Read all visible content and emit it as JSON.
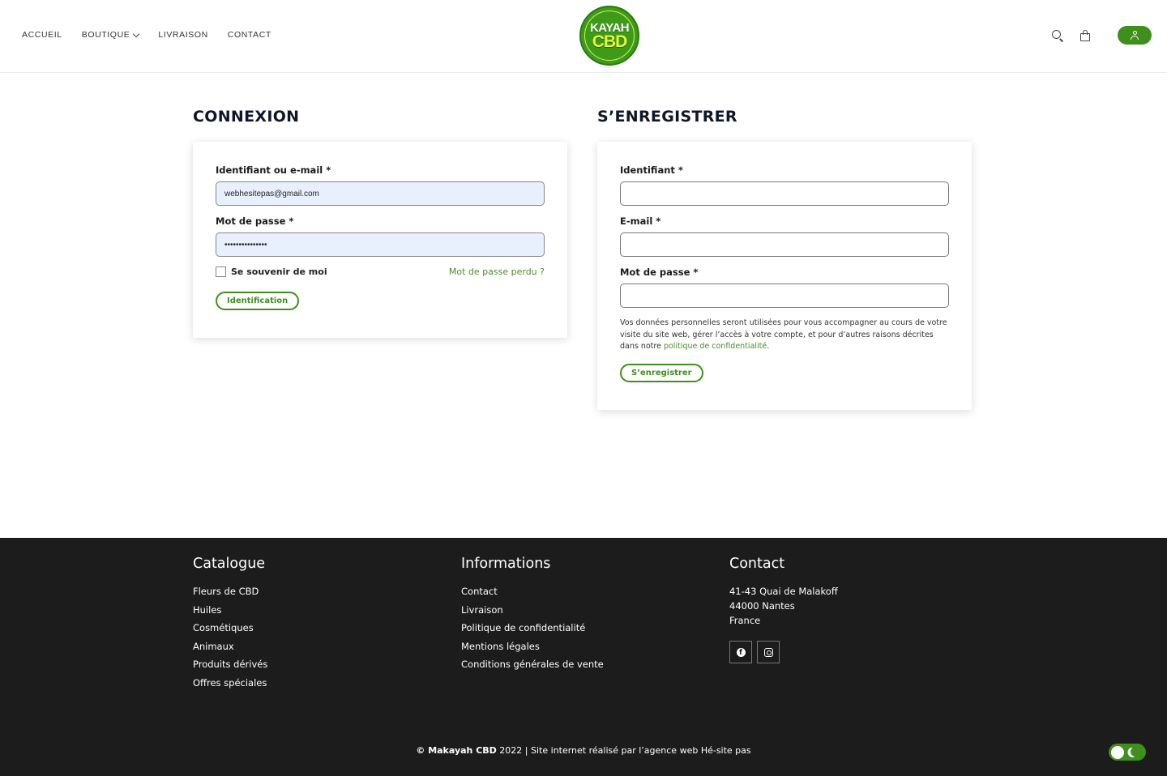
{
  "header": {
    "nav": [
      {
        "label": "ACCUEIL"
      },
      {
        "label": "BOUTIQUE",
        "has_dropdown": true
      },
      {
        "label": "LIVRAISON"
      },
      {
        "label": "CONTACT"
      }
    ],
    "logo": {
      "line1": "KAYAH",
      "line2": "CBD"
    },
    "icons": [
      "search-icon",
      "bag-icon",
      "user-icon"
    ]
  },
  "login": {
    "title": "CONNEXION",
    "username_label": "Identifiant ou e-mail *",
    "username_value": "webhesitepas@gmail.com",
    "password_label": "Mot de passe *",
    "password_value": "•••••••••••••••",
    "remember_label": "Se souvenir de moi",
    "lost_password": "Mot de passe perdu ?",
    "submit": "Identification"
  },
  "register": {
    "title": "S’ENREGISTRER",
    "username_label": "Identifiant *",
    "email_label": "E-mail *",
    "password_label": "Mot de passe *",
    "privacy_text": "Vos données personnelles seront utilisées pour vous accompagner au cours de votre visite du site web, gérer l’accès à votre compte, et pour d’autres raisons décrites dans notre ",
    "privacy_link": "politique de confidentialité",
    "privacy_end": ".",
    "submit": "S’enregistrer"
  },
  "footer": {
    "catalogue": {
      "title": "Catalogue",
      "items": [
        "Fleurs de CBD",
        "Huiles",
        "Cosmétiques",
        "Animaux",
        "Produits dérivés",
        "Offres spéciales"
      ]
    },
    "informations": {
      "title": "Informations",
      "items": [
        "Contact",
        "Livraison",
        "Politique de confidentialité",
        "Mentions légales",
        "Conditions générales de vente"
      ]
    },
    "contact": {
      "title": "Contact",
      "address": [
        "41-43 Quai de Malakoff",
        "44000 Nantes",
        "France"
      ],
      "socials": [
        "facebook-icon",
        "instagram-icon"
      ]
    },
    "copyright_brand": "© Makayah CBD",
    "copyright_rest": " 2022 | Site internet réalisé par l’agence web Hé-site pas"
  },
  "colors": {
    "accent": "#3e8f1c",
    "link": "#4e8a2c",
    "footer_bg": "#1c1c1c",
    "title": "#0e1628"
  }
}
